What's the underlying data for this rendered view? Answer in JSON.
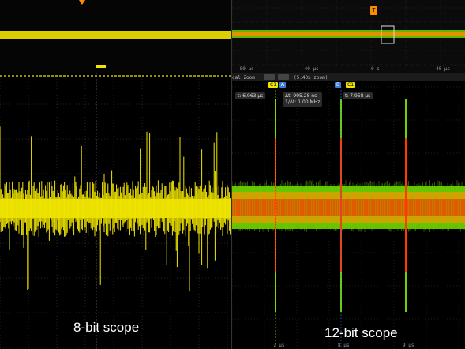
{
  "left_panel": {
    "caption": "8-bit scope",
    "colors": {
      "trace": "#f2e600",
      "grid": "#5a5a5a",
      "marker": "#ff8c00"
    }
  },
  "right_panel": {
    "caption": "12-bit scope",
    "overview_time_labels": [
      "-80 µs",
      "-40 µs",
      "0 s",
      "40 µs"
    ],
    "trigger_label": "T",
    "zoom_label": "cal Zoom",
    "zoom_factor": "(5.40x zoom)",
    "cursor_a": {
      "channel": "C1",
      "tag": "A",
      "time": "t: 6.963 µs"
    },
    "cursor_b": {
      "channel": "C1",
      "tag": "B",
      "time": "t: 7.958 µs"
    },
    "delta_t": "Δt: 995.28 ns",
    "inv_delta_t": "1/Δt: 1.00 MHz",
    "bottom_time_labels": [
      "7 µs",
      "8 µs",
      "9 µs"
    ],
    "colors": {
      "low": "#ff3b00",
      "mid": "#ff8c00",
      "high": "#6fd400",
      "peak": "#f2e600",
      "cursor_a": "#f2e600",
      "cursor_b": "#3b7dd8"
    }
  }
}
